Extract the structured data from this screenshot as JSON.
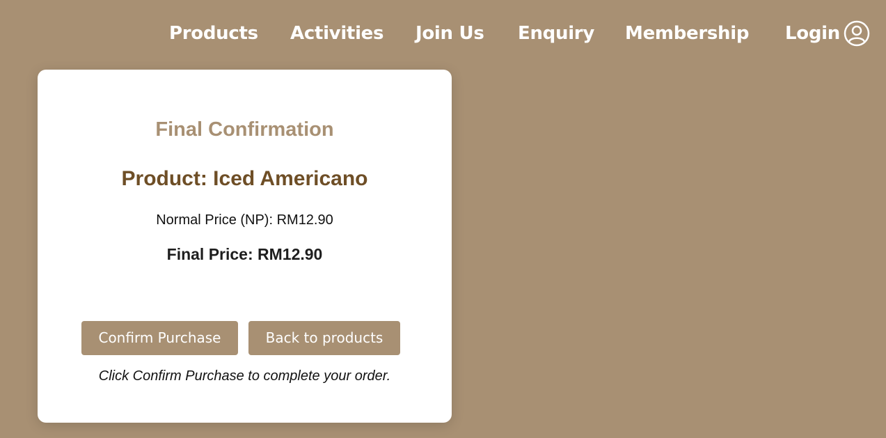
{
  "nav": {
    "items": [
      {
        "label": "Products"
      },
      {
        "label": "Activities"
      },
      {
        "label": "Join Us"
      },
      {
        "label": "Enquiry"
      },
      {
        "label": "Membership"
      },
      {
        "label": "Login"
      }
    ],
    "login_icon": "user-circle-icon"
  },
  "card": {
    "title": "Final Confirmation",
    "product": "Product: Iced Americano",
    "normal_price": "Normal Price (NP): RM12.90",
    "final_price": "Final Price: RM12.90",
    "confirm_label": "Confirm Purchase",
    "back_label": "Back to products",
    "hint": "Click Confirm Purchase to complete your order."
  },
  "colors": {
    "background": "#a89073",
    "card": "#ffffff",
    "title": "#a89073",
    "product": "#6e4e26",
    "button": "#a89073"
  }
}
